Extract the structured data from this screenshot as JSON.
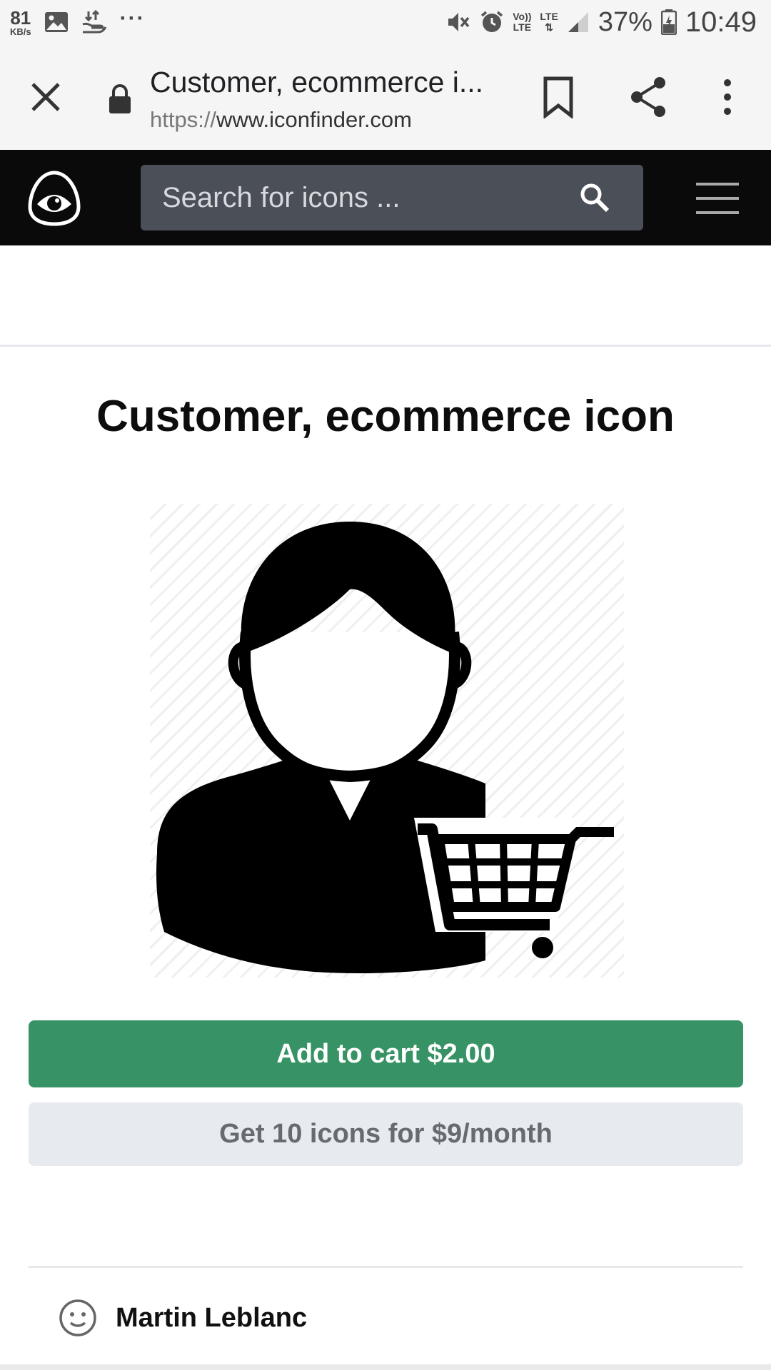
{
  "status_bar": {
    "speed_value": "81",
    "speed_unit": "KB/s",
    "overflow_dots": "···",
    "volte_top": "Vo))",
    "volte_bottom": "LTE",
    "lte_label": "LTE",
    "battery_percent": "37%",
    "time": "10:49"
  },
  "browser": {
    "page_title": "Customer, ecommerce i...",
    "url_scheme": "https://",
    "url_host": "www.iconfinder.com"
  },
  "site_header": {
    "search_placeholder": "Search for icons ..."
  },
  "main": {
    "title": "Customer, ecommerce icon",
    "add_to_cart_label": "Add to cart $2.00",
    "subscription_label": "Get 10 icons for $9/month",
    "author_name": "Martin Leblanc"
  },
  "colors": {
    "cart_button": "#379365",
    "plan_button": "#e7eaee",
    "header_bg": "#0a0a0a",
    "search_bg": "#4b4f58"
  }
}
